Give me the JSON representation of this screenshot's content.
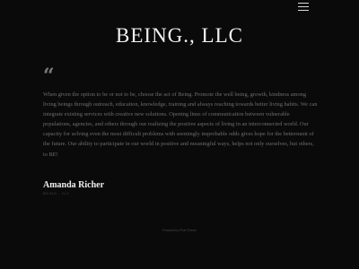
{
  "header": {
    "title": "BEING., LLC",
    "menu_icon": "hamburger-menu-icon"
  },
  "testimonial": {
    "quote_icon": "left-double-quote-icon",
    "quote_glyph": "“",
    "text": "When given the option to be or not to be, choose the act of Being.  Promote the well being, growth, kindness among living beings through outreach, education, knowledge, training and always reaching towards better living habits.  We can integrate existing services with creative new solutions. Opening lines of communication between vulnerable populations, agencies, and others through our realizing the positive aspects of living in an interconnected world. Our capacity for solving even the most difficult problems with seemingly improbable odds gives hope for the betterment of the future.  Our ability to participate in our world in positive and meaningful ways, helps not only ourselves, but others, to BE!",
    "author_name": "Amanda Richer",
    "author_role": "BEING., LLC"
  },
  "footer": {
    "prefix": "Powered by",
    "link_text": "Pixel Theme"
  },
  "colors": {
    "background": "#0a0a0a",
    "title": "#f2f2f2",
    "body_text": "#6e6e6e"
  }
}
